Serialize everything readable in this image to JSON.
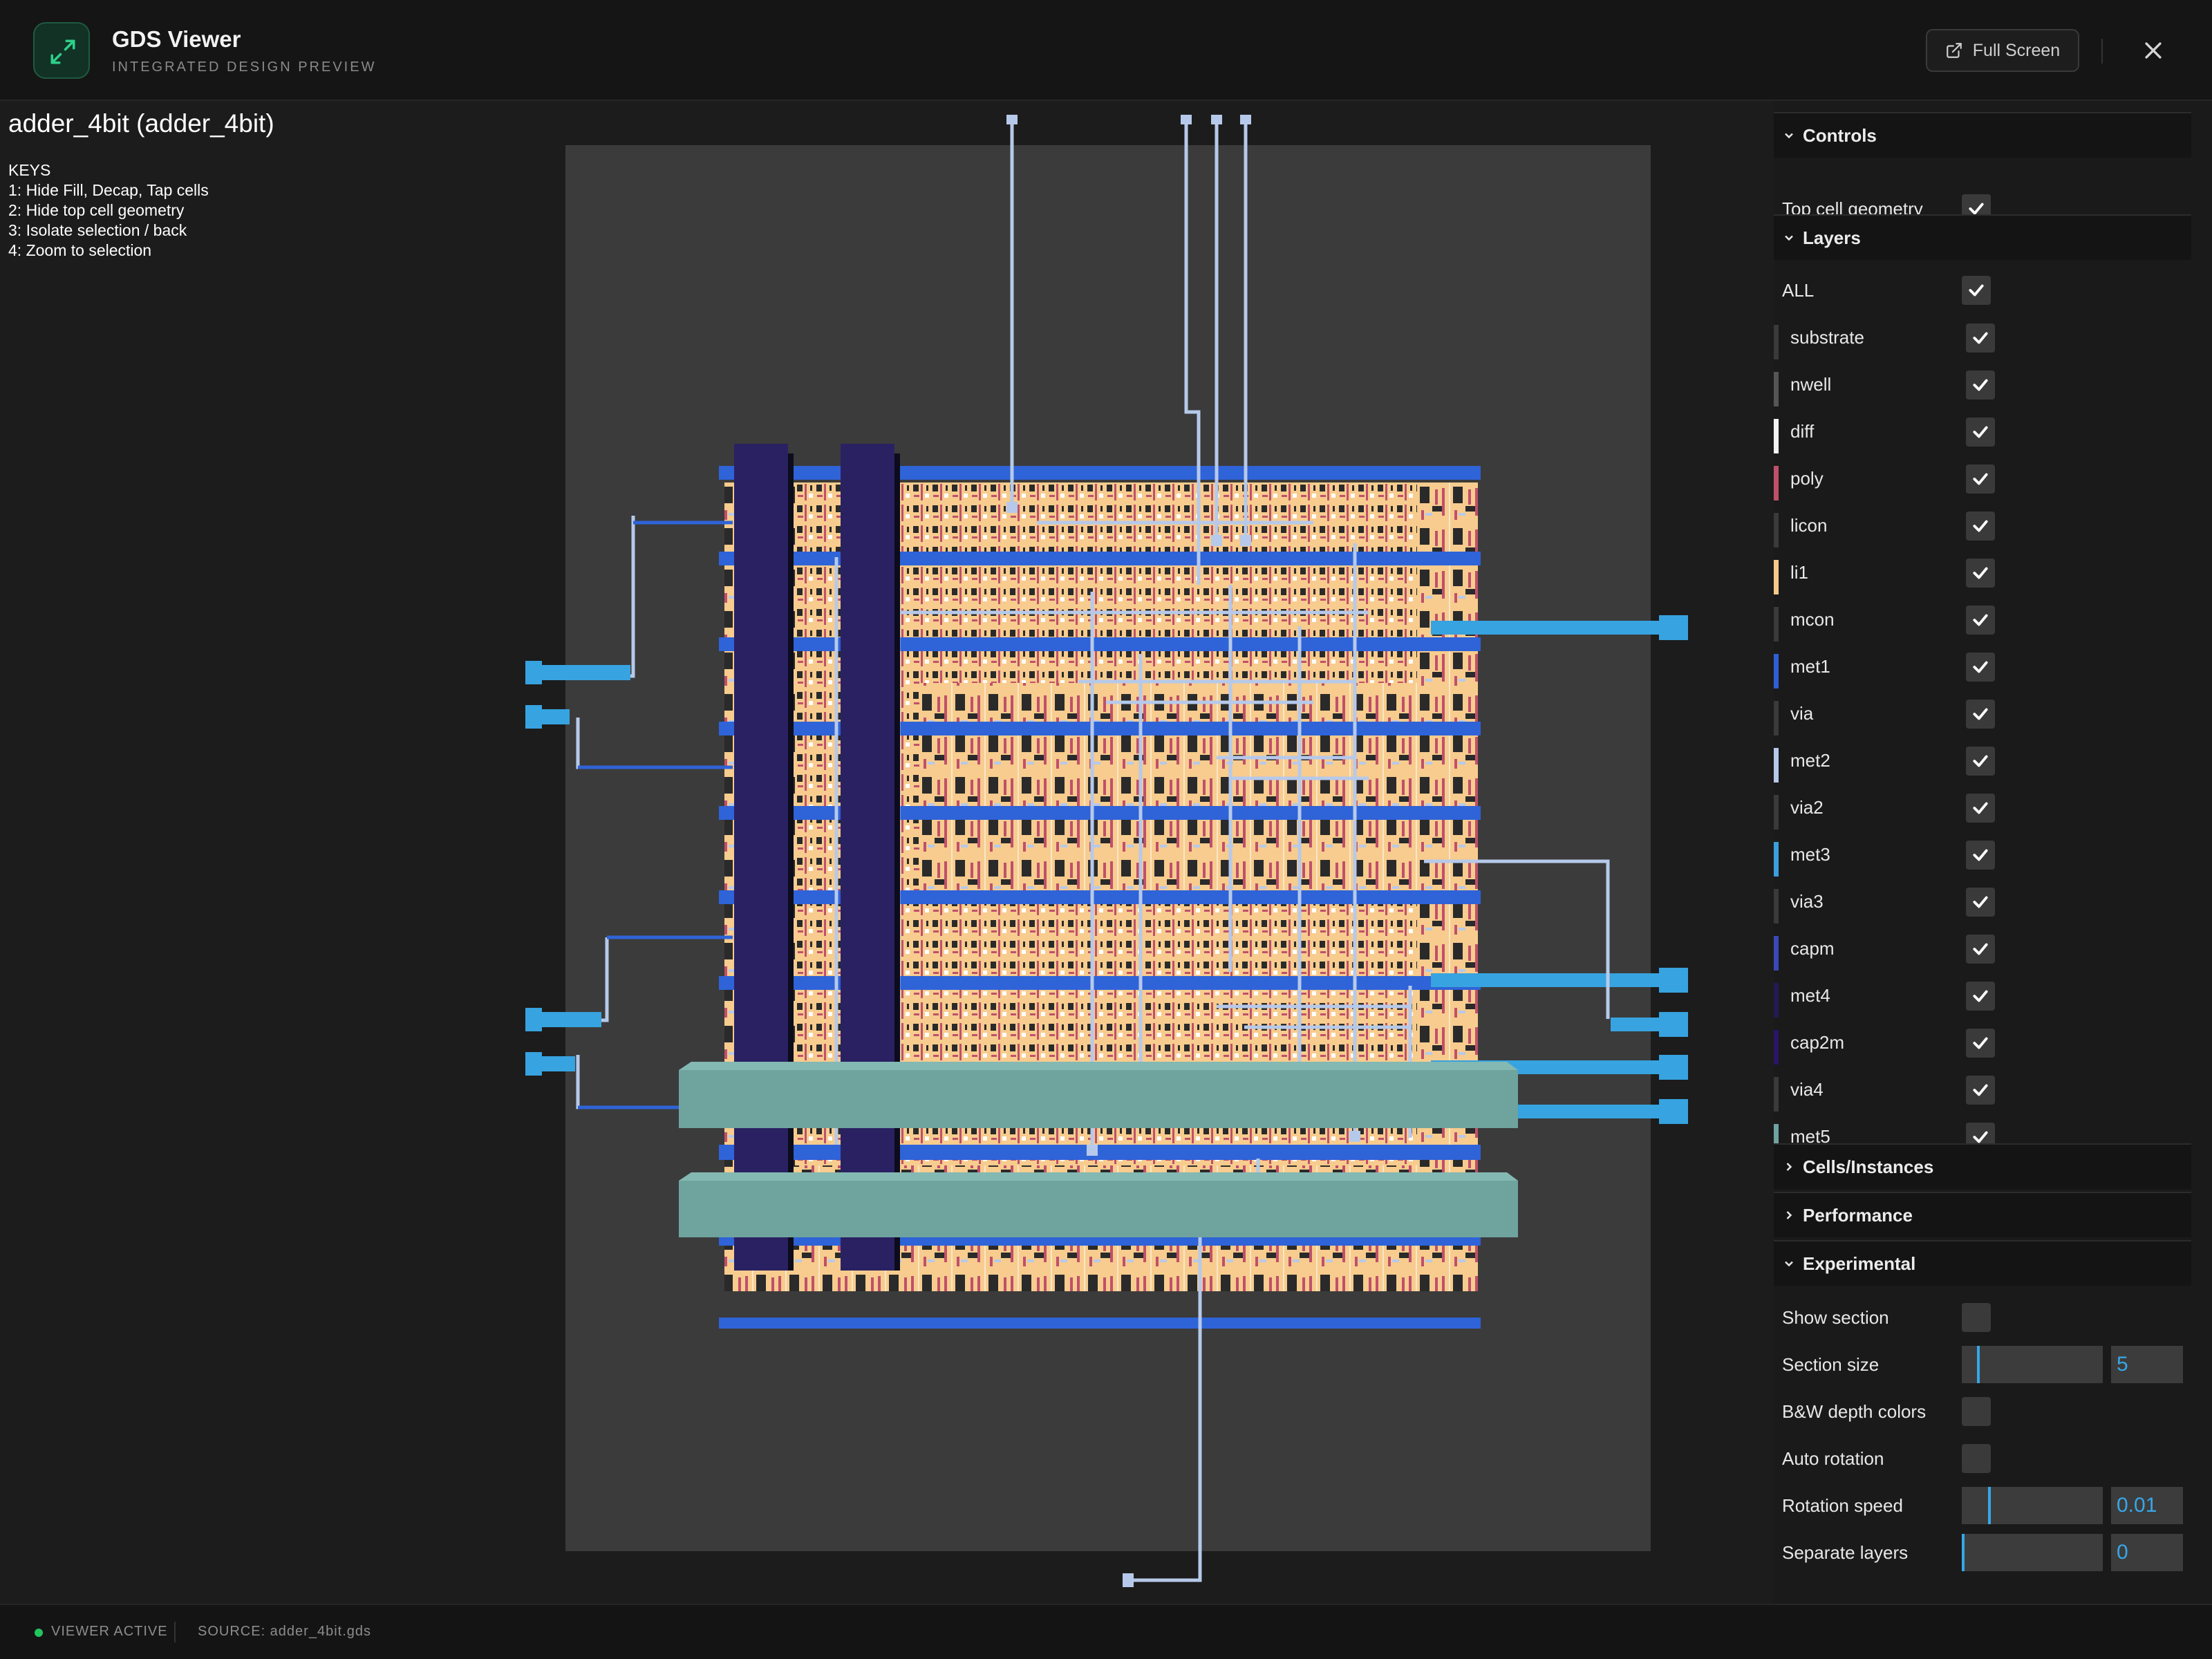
{
  "header": {
    "title": "GDS Viewer",
    "subtitle": "INTEGRATED DESIGN PREVIEW",
    "fullscreen_label": "Full Screen",
    "icons": {
      "app": "expand-arrows-icon",
      "fullscreen": "external-link-icon",
      "close": "close-icon"
    }
  },
  "viewer": {
    "title": "adder_4bit (adder_4bit)",
    "keys_heading": "KEYS",
    "keys": [
      "1: Hide Fill, Decap, Tap cells",
      "2: Hide top cell geometry",
      "3: Isolate selection / back",
      "4: Zoom to selection"
    ]
  },
  "panel": {
    "controls": {
      "heading": "Controls",
      "top_cell_geometry_label": "Top cell geometry",
      "top_cell_geometry_checked": true
    },
    "layers": {
      "heading": "Layers",
      "all_label": "ALL",
      "all_checked": true,
      "items": [
        {
          "name": "substrate",
          "color": "#3a3a3a",
          "checked": true
        },
        {
          "name": "nwell",
          "color": "#555555",
          "checked": true
        },
        {
          "name": "diff",
          "color": "#f2f2f2",
          "checked": true
        },
        {
          "name": "poly",
          "color": "#c0506a",
          "checked": true
        },
        {
          "name": "licon",
          "color": "#3a3a3a",
          "checked": true
        },
        {
          "name": "li1",
          "color": "#f5c98a",
          "checked": true
        },
        {
          "name": "mcon",
          "color": "#3a3a3a",
          "checked": true
        },
        {
          "name": "met1",
          "color": "#2f5fd6",
          "checked": true
        },
        {
          "name": "via",
          "color": "#3a3a3a",
          "checked": true
        },
        {
          "name": "met2",
          "color": "#b6c9ea",
          "checked": true
        },
        {
          "name": "via2",
          "color": "#3a3a3a",
          "checked": true
        },
        {
          "name": "met3",
          "color": "#3aa0dc",
          "checked": true
        },
        {
          "name": "via3",
          "color": "#3a3a3a",
          "checked": true
        },
        {
          "name": "capm",
          "color": "#3a48b8",
          "checked": true
        },
        {
          "name": "met4",
          "color": "#241a52",
          "checked": true
        },
        {
          "name": "cap2m",
          "color": "#2a1466",
          "checked": true
        },
        {
          "name": "via4",
          "color": "#3a3a3a",
          "checked": true
        },
        {
          "name": "met5",
          "color": "#6fa39e",
          "checked": true
        }
      ]
    },
    "cells": {
      "heading": "Cells/Instances"
    },
    "performance": {
      "heading": "Performance"
    },
    "experimental": {
      "heading": "Experimental",
      "show_section_label": "Show section",
      "show_section_checked": false,
      "section_size_label": "Section size",
      "section_size_value": "5",
      "bw_label": "B&W depth colors",
      "bw_checked": false,
      "auto_rotation_label": "Auto rotation",
      "auto_rotation_checked": false,
      "rotation_speed_label": "Rotation speed",
      "rotation_speed_value": "0.01",
      "separate_layers_label": "Separate layers",
      "separate_layers_value": "0"
    }
  },
  "footer": {
    "status": "VIEWER ACTIVE",
    "source": "SOURCE: adder_4bit.gds",
    "status_color": "#22c55e"
  }
}
